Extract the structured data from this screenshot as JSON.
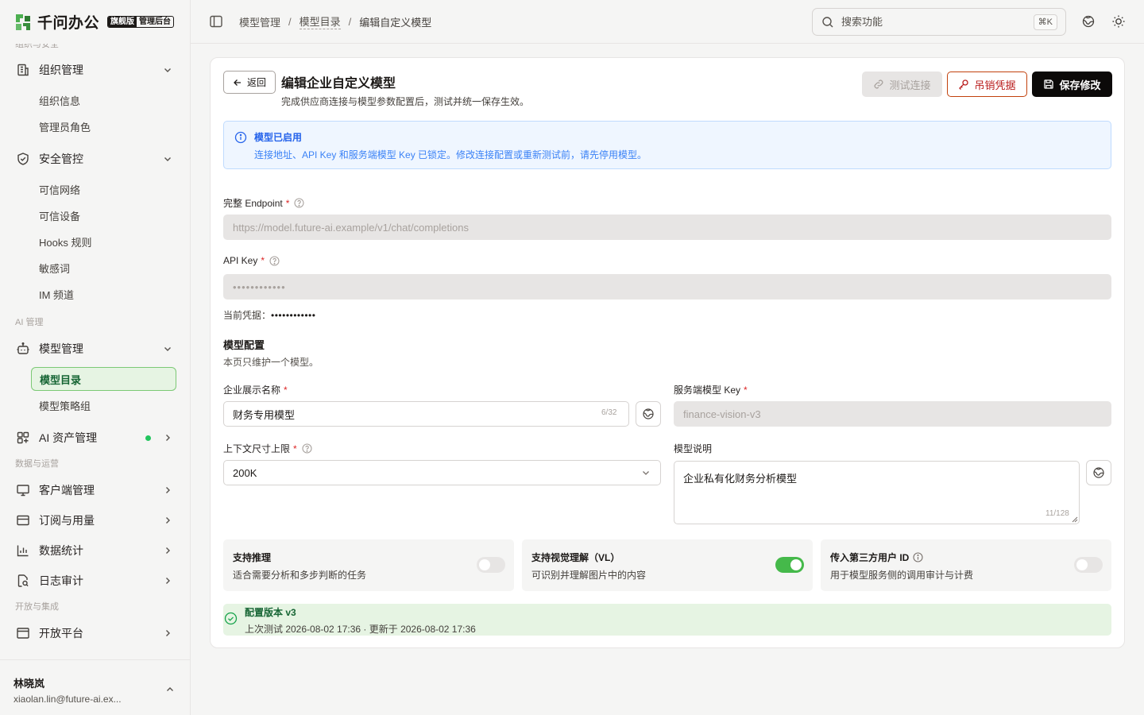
{
  "brand": {
    "name": "千问办公",
    "badge_edition": "旗舰版",
    "badge_admin": "管理后台"
  },
  "sidebar": {
    "cut_section": "组织与安全",
    "groups": [
      {
        "label": "组织管理",
        "icon": "building-icon"
      },
      {
        "label": "安全管控",
        "icon": "shield-check-icon"
      },
      {
        "label": "模型管理",
        "icon": "bot-icon"
      },
      {
        "label": "AI 资产管理",
        "icon": "grid-plus-icon",
        "status": "green-dot"
      },
      {
        "label": "客户端管理",
        "icon": "monitor-icon"
      },
      {
        "label": "订阅与用量",
        "icon": "credit-card-icon"
      },
      {
        "label": "数据统计",
        "icon": "bar-chart-icon"
      },
      {
        "label": "日志审计",
        "icon": "file-search-icon"
      },
      {
        "label": "开放平台",
        "icon": "app-window-icon"
      }
    ],
    "org_items": [
      "组织信息",
      "管理员角色"
    ],
    "security_items": [
      "可信网络",
      "可信设备",
      "Hooks 规则",
      "敏感词",
      "IM 频道"
    ],
    "section_ai": "AI 管理",
    "model_items": [
      "模型目录",
      "模型策略组"
    ],
    "section_data": "数据与运营",
    "section_open": "开放与集成",
    "user": {
      "name": "林晓岚",
      "email": "xiaolan.lin@future-ai.ex..."
    }
  },
  "topbar": {
    "breadcrumb": [
      "模型管理",
      "模型目录",
      "编辑自定义模型"
    ],
    "search_placeholder": "搜索功能",
    "search_shortcut": "⌘K"
  },
  "page": {
    "back_label": "返回",
    "title": "编辑企业自定义模型",
    "subtitle": "完成供应商连接与模型参数配置后，测试并统一保存生效。",
    "test_label": "测试连接",
    "revoke_label": "吊销凭据",
    "save_label": "保存修改"
  },
  "alert": {
    "title": "模型已启用",
    "text": "连接地址、API Key 和服务端模型 Key 已锁定。修改连接配置或重新测试前，请先停用模型。"
  },
  "form": {
    "endpoint_label": "完整 Endpoint",
    "endpoint_value": "https://model.future-ai.example/v1/chat/completions",
    "apikey_label": "API Key",
    "apikey_value": "••••••••••••",
    "current_cred_label": "当前凭据：",
    "current_cred_value": "••••••••••••",
    "section_title": "模型配置",
    "section_sub": "本页只维护一个模型。",
    "display_name_label": "企业展示名称",
    "display_name_value": "财务专用模型",
    "display_name_count": "6/32",
    "server_key_label": "服务端模型 Key",
    "server_key_value": "finance-vision-v3",
    "context_label": "上下文尺寸上限",
    "context_value": "200K",
    "desc_label": "模型说明",
    "desc_value": "企业私有化财务分析模型",
    "desc_count": "11/128"
  },
  "toggles": [
    {
      "title": "支持推理",
      "desc": "适合需要分析和多步判断的任务",
      "on": false
    },
    {
      "title": "支持视觉理解（VL）",
      "desc": "可识别并理解图片中的内容",
      "on": true
    },
    {
      "title": "传入第三方用户 ID",
      "desc": "用于模型服务侧的调用审计与计费",
      "on": false
    }
  ],
  "version": {
    "title": "配置版本 v3",
    "detail": "上次测试 2026-08-02 17:36 · 更新于 2026-08-02 17:36"
  },
  "colors": {
    "accent_green": "#45b94a",
    "danger": "#b91c1c",
    "info": "#2563eb"
  }
}
